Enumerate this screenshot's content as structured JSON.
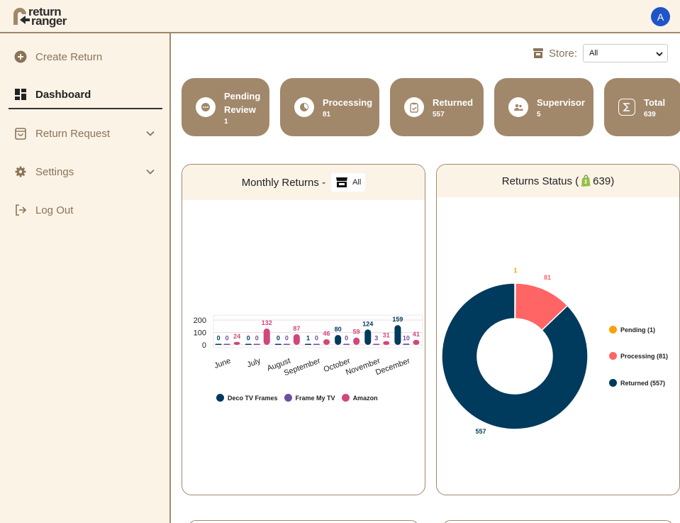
{
  "header": {
    "logo_line1": "return",
    "logo_line2": "ranger",
    "avatar_initial": "A",
    "avatar_color": "#1f55c7"
  },
  "sidebar": {
    "items": [
      {
        "label": "Create Return",
        "icon": "plus-circle-icon"
      },
      {
        "label": "Dashboard",
        "icon": "dashboard-grid-icon",
        "active": true
      },
      {
        "label": "Return Request",
        "icon": "shopping-bag-icon",
        "expandable": true
      },
      {
        "label": "Settings",
        "icon": "gear-icon",
        "expandable": true
      },
      {
        "label": "Log Out",
        "icon": "logout-icon"
      }
    ]
  },
  "store_filter": {
    "label": "Store:",
    "selected": "All"
  },
  "stat_cards": [
    {
      "title_line1": "Pending",
      "title_line2": "Review",
      "value": "1",
      "icon": "ellipsis-icon"
    },
    {
      "title_line1": "Processing",
      "value": "81",
      "icon": "progress-pie-icon"
    },
    {
      "title_line1": "Returned",
      "value": "557",
      "icon": "clipboard-check-icon"
    },
    {
      "title_line1": "Supervisor",
      "value": "5",
      "icon": "users-icon"
    },
    {
      "title_line1": "Total",
      "value": "639",
      "icon": "sigma-icon"
    }
  ],
  "monthly_panel": {
    "title": "Monthly Returns -",
    "store_pill": "All"
  },
  "status_panel": {
    "title_prefix": "Returns Status (",
    "total": "639",
    "title_suffix": ")"
  },
  "colors": {
    "brand_brown": "#a1886a",
    "cream": "#fcf3e7",
    "deco": "#003a5c",
    "frame_my_tv": "#6d4fa0",
    "amazon": "#d1477a",
    "pending": "#f5a30a",
    "processing": "#ff6565",
    "returned": "#003a5c"
  },
  "chart_data": [
    {
      "type": "bar",
      "title": "Monthly Returns",
      "categories": [
        "June",
        "July",
        "August",
        "September",
        "October",
        "November",
        "December"
      ],
      "yticks": [
        "200",
        "100",
        "0"
      ],
      "ylim": [
        0,
        200
      ],
      "series": [
        {
          "name": "Deco TV Frames",
          "values": [
            0,
            0,
            0,
            1,
            80,
            124,
            159
          ]
        },
        {
          "name": "Frame My TV",
          "values": [
            0,
            0,
            0,
            0,
            0,
            3,
            10
          ]
        },
        {
          "name": "Amazon",
          "values": [
            24,
            132,
            87,
            46,
            59,
            31,
            41
          ]
        }
      ],
      "legend_position": "bottom"
    },
    {
      "type": "pie",
      "variant": "donut",
      "labels": [
        "Pending (1)",
        "Processing (81)",
        "Returned (557)"
      ],
      "values": [
        1,
        81,
        557
      ],
      "legend_position": "right"
    }
  ]
}
